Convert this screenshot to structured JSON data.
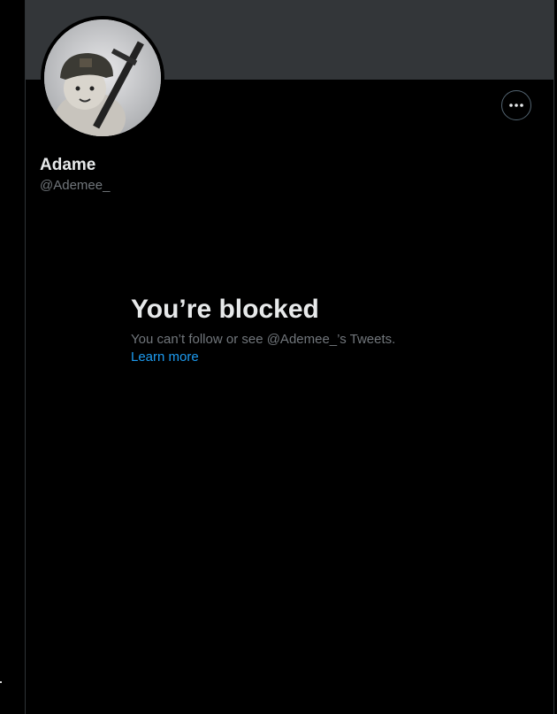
{
  "profile": {
    "display_name": "Adame",
    "handle": "@Ademee_",
    "avatar_icon": "avatar-image",
    "banner_color": "#333639"
  },
  "actions": {
    "more_icon": "more-horizontal-icon"
  },
  "blocked_notice": {
    "title": "You’re blocked",
    "message": "You can’t follow or see @Ademee_’s Tweets.",
    "learn_more": "Learn more"
  },
  "colors": {
    "background": "#000000",
    "primary_text": "#e7e9ea",
    "secondary_text": "#71767b",
    "link": "#1d9bf0",
    "border": "#2f3336"
  }
}
